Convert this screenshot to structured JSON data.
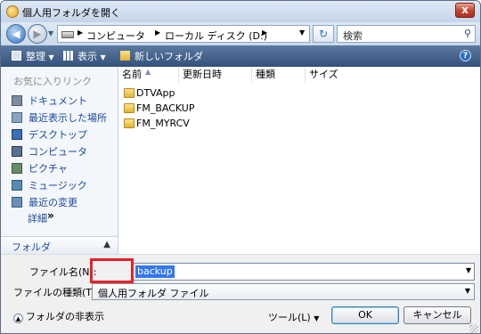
{
  "window": {
    "title": "個人用フォルダを開く",
    "close_glyph": "x"
  },
  "address": {
    "segments": [
      "コンピュータ",
      "ローカル ディスク (D:)"
    ],
    "search_placeholder": "検索"
  },
  "toolbar": {
    "organize": "整理",
    "views": "表示",
    "new_folder": "新しいフォルダ"
  },
  "sidebar": {
    "header": "お気に入りリンク",
    "items": [
      {
        "label": "ドキュメント",
        "icon": "documents-icon"
      },
      {
        "label": "最近表示した場所",
        "icon": "recent-places-icon"
      },
      {
        "label": "デスクトップ",
        "icon": "desktop-icon"
      },
      {
        "label": "コンピュータ",
        "icon": "computer-icon"
      },
      {
        "label": "ピクチャ",
        "icon": "pictures-icon"
      },
      {
        "label": "ミュージック",
        "icon": "music-icon"
      },
      {
        "label": "最近の変更",
        "icon": "recently-changed-icon"
      }
    ],
    "more": "詳細",
    "folders": "フォルダ"
  },
  "filelist": {
    "columns": [
      "名前",
      "更新日時",
      "種類",
      "サイズ"
    ],
    "rows": [
      {
        "name": "DTVApp"
      },
      {
        "name": "FM_BACKUP"
      },
      {
        "name": "FM_MYRCV"
      }
    ]
  },
  "bottom": {
    "filename_label": "ファイル名(N):",
    "filename_value": "backup",
    "filetype_label": "ファイルの種類(T):",
    "filetype_value": "個人用フォルダ ファイル",
    "hide_folders": "フォルダの非表示",
    "tools": "ツール(L)",
    "ok": "OK",
    "cancel": "キャンセル"
  },
  "colors": {
    "highlight": "#e8202a",
    "selection": "#3377ee",
    "toolbar": "#3d5b85"
  }
}
